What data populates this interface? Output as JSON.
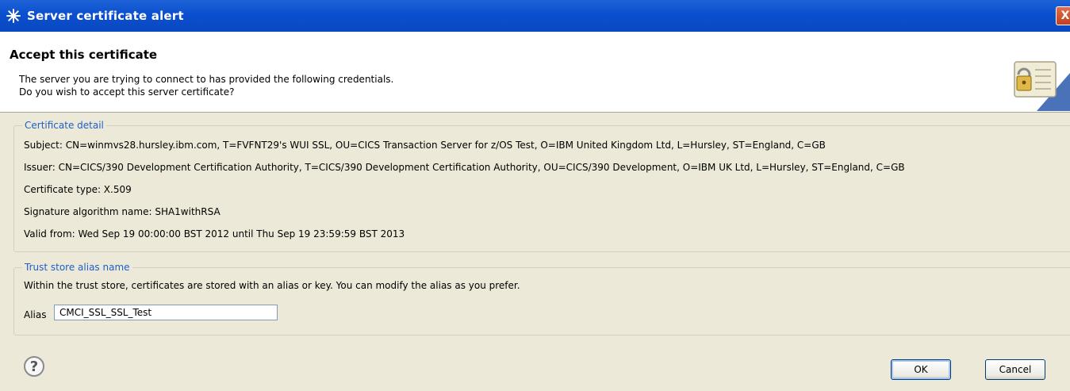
{
  "window": {
    "title": "Server certificate alert",
    "close_symbol": "X"
  },
  "header": {
    "title": "Accept this certificate",
    "desc_line1": "The server you are trying to connect to has provided the following credentials.",
    "desc_line2": "Do you wish to accept this server certificate?",
    "icon": "certificate-lock-icon"
  },
  "certificate_detail": {
    "legend": "Certificate detail",
    "subject": "Subject: CN=winmvs28.hursley.ibm.com, T=FVFNT29's WUI SSL, OU=CICS Transaction Server for z/OS Test, O=IBM United Kingdom Ltd, L=Hursley, ST=England, C=GB",
    "issuer": "Issuer: CN=CICS/390 Development Certification Authority, T=CICS/390 Development Certification Authority, OU=CICS/390 Development, O=IBM UK Ltd, L=Hursley, ST=England, C=GB",
    "type": "Certificate type: X.509",
    "signature": "Signature algorithm name: SHA1withRSA",
    "valid": "Valid from: Wed Sep 19 00:00:00 BST 2012 until Thu Sep 19 23:59:59 BST 2013"
  },
  "trust_store": {
    "legend": "Trust store alias name",
    "description": "Within the trust store, certificates are stored with an alias or key. You can modify the alias as you prefer.",
    "alias_label": "Alias",
    "alias_value": "CMCI_SSL_SSL_Test"
  },
  "buttons": {
    "help_symbol": "?",
    "ok": "OK",
    "cancel": "Cancel"
  },
  "colors": {
    "titlebar": "#0a4fcf",
    "body_bg": "#ece9d8",
    "legend_text": "#1e5fc8"
  }
}
